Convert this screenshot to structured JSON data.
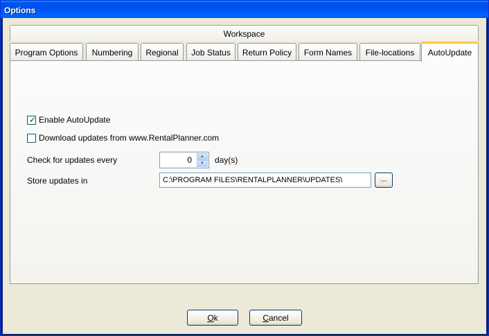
{
  "window": {
    "title": "Options"
  },
  "workspace": {
    "title": "Workspace"
  },
  "tabs": [
    {
      "label": "Program Options"
    },
    {
      "label": "Numbering"
    },
    {
      "label": "Regional"
    },
    {
      "label": "Job Status"
    },
    {
      "label": "Return Policy"
    },
    {
      "label": "Form Names"
    },
    {
      "label": "File-locations"
    },
    {
      "label": "AutoUpdate"
    }
  ],
  "active_tab": "AutoUpdate",
  "autoupdate": {
    "enable_label": "Enable AutoUpdate",
    "enable_checked": true,
    "download_label": "Download updates from www.RentalPlanner.com",
    "download_checked": false,
    "check_label": "Check for updates every",
    "check_value": "0",
    "check_unit": "day(s)",
    "store_label": "Store updates in",
    "store_path": "C:\\PROGRAM FILES\\RENTALPLANNER\\UPDATES\\",
    "browse_label": "..."
  },
  "buttons": {
    "ok_first": "O",
    "ok_rest": "k",
    "cancel_first": "C",
    "cancel_rest": "ancel"
  }
}
